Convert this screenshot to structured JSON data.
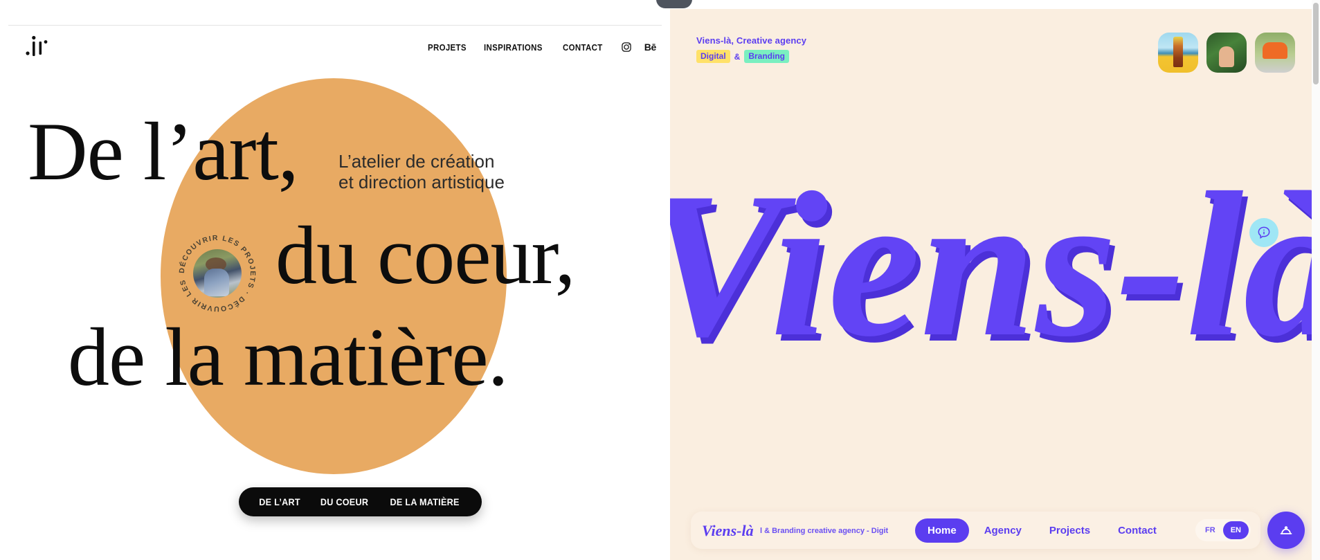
{
  "left_site": {
    "logo_alt": "jr-monogram-logo",
    "nav": [
      {
        "label": "PROJETS",
        "name": "nav-projets"
      },
      {
        "label": "INSPIRATIONS",
        "name": "nav-inspirations"
      },
      {
        "label": "CONTACT",
        "name": "nav-contact"
      }
    ],
    "social": {
      "instagram": "instagram-icon",
      "behance_label": "Bē"
    },
    "hero": {
      "line1": "De l’art,",
      "line2": "du coeur,",
      "line3": "de la matière.",
      "subtitle": "L’atelier de création\net direction artistique"
    },
    "badge": {
      "circular_text": "DÉCOUVRIR LES PROJETS · DÉCOUVRIR LES PROJETS · ",
      "photo_alt": "woman-sitting-photo"
    },
    "pill": {
      "word1": "DE L’ART",
      "word2": "DU COEUR",
      "word3": "DE LA MATIÈRE"
    },
    "colors": {
      "accent": "#e8aa63",
      "text": "#0d0d0d",
      "pill_bg": "#0b0b0b"
    }
  },
  "right_site": {
    "tagline": {
      "main": "Viens-là, Creative agency",
      "tag_digital": "Digital",
      "amp": "&",
      "tag_branding": "Branding"
    },
    "thumbnails": [
      {
        "alt": "rum-bottle-beach-thumbnail"
      },
      {
        "alt": "hand-holding-leaf-thumbnail"
      },
      {
        "alt": "orange-bbq-grill-thumbnail"
      }
    ],
    "wordmark": "Viens-là",
    "info_bubble": "info-chat-icon",
    "bottom_bar": {
      "brand": "Viens-là",
      "marquee": "l & Branding creative agency  -  Digit",
      "links": [
        {
          "label": "Home",
          "active": true
        },
        {
          "label": "Agency",
          "active": false
        },
        {
          "label": "Projects",
          "active": false
        },
        {
          "label": "Contact",
          "active": false
        }
      ],
      "lang": [
        {
          "label": "FR",
          "active": false
        },
        {
          "label": "EN",
          "active": true
        }
      ]
    },
    "fab_icon": "bell-cloche-icon",
    "colors": {
      "background": "#faeee0",
      "purple": "#5b3df0",
      "highlight_yellow": "#ffe169",
      "highlight_green": "#7aefc0",
      "info_bubble_bg": "#9fe6f5"
    }
  }
}
